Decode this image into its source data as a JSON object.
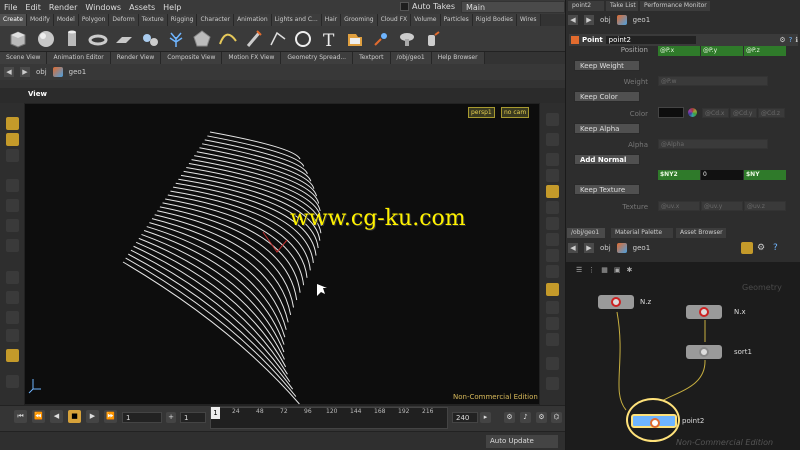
{
  "menu": [
    "File",
    "Edit",
    "Render",
    "Windows",
    "Assets",
    "Help"
  ],
  "auto_takes": "Auto Takes",
  "takes_value": "Main",
  "shelf_tabs": [
    "Create",
    "Modify",
    "Model",
    "Polygon",
    "Deform",
    "Texture",
    "Rigging",
    "Character",
    "Animation",
    "Lights and C...",
    "Hair",
    "Grooming",
    "Cloud FX",
    "Volume",
    "Particles",
    "Rigid Bodies",
    "Wires"
  ],
  "pane_tabs": [
    "Scene View",
    "Animation Editor",
    "Render View",
    "Composite View",
    "Motion FX View",
    "Geometry Spread...",
    "Textport",
    "/obj/geo1",
    "Help Browser"
  ],
  "path": {
    "obj": "obj",
    "geo": "geo1"
  },
  "viewport": {
    "label": "View",
    "persp": "persp1",
    "cam": "no cam",
    "watermark": "www.cg-ku.com",
    "edition": "Non-Commercial Edition"
  },
  "timeline": {
    "start": "1",
    "range_start": "1",
    "current": "1",
    "end": "240",
    "ticks": [
      "24",
      "48",
      "72",
      "96",
      "120",
      "144",
      "168",
      "192",
      "216"
    ],
    "auto_update": "Auto Update"
  },
  "params": {
    "top_tabs": [
      "point2",
      "Take List",
      "Performance Monitor"
    ],
    "path": {
      "obj": "obj",
      "geo": "geo1"
    },
    "node_type": "Point",
    "node_name": "point2",
    "position_label": "Position",
    "pos": [
      "@P.x",
      "@P.y",
      "@P.z"
    ],
    "keep_weight": "Keep Weight",
    "weight_label": "Weight",
    "weight_val": "@P.w",
    "keep_color": "Keep Color",
    "color_label": "Color",
    "color_vals": [
      "@Cd.x",
      "@Cd.y",
      "@Cd.z"
    ],
    "keep_alpha": "Keep Alpha",
    "alpha_label": "Alpha",
    "alpha_val": "@Alpha",
    "add_normal": "Add Normal",
    "normal_vals": [
      "$NY2",
      "0",
      "$NY"
    ],
    "keep_texture": "Keep Texture",
    "texture_label": "Texture",
    "tex_vals": [
      "@uv.x",
      "@uv.y",
      "@uv.z"
    ]
  },
  "network": {
    "tabs": [
      "/obj/geo1",
      "Material Palette",
      "Asset Browser"
    ],
    "path": {
      "obj": "obj",
      "geo": "geo1"
    },
    "geometry_label": "Geometry",
    "nodes": {
      "nz": "N.z",
      "nx": "N.x",
      "sort": "sort1",
      "point": "point2"
    },
    "edition": "Non-Commercial Edition"
  }
}
